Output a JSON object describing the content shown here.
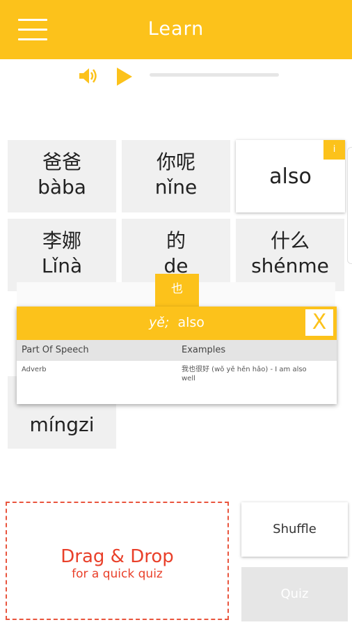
{
  "header": {
    "title": "Learn",
    "menu_icon": "hamburger-icon"
  },
  "audio": {
    "volume_icon": "volume-icon",
    "play_icon": "play-icon",
    "progress": 0,
    "accent": "#FCC21B"
  },
  "tiles": [
    {
      "hanzi": "爸爸",
      "pinyin": "bàba"
    },
    {
      "hanzi": "你呢",
      "pinyin": "nǐne"
    },
    {
      "word": "also",
      "badge": "i"
    },
    {
      "hanzi": "李娜",
      "pinyin": "Lǐnà"
    },
    {
      "hanzi": "的",
      "pinyin": "de"
    },
    {
      "hanzi": "什么",
      "pinyin": "shénme"
    },
    {
      "pinyin": "míngzi"
    }
  ],
  "popup": {
    "tab": "也",
    "pinyin": "yě;",
    "meaning": "also",
    "close": "X",
    "col_pos": "Part Of Speech",
    "col_examples": "Examples",
    "pos": "Adverb",
    "example": "我也很好 (wǒ yě hěn hǎo) - I am also well"
  },
  "quiz": {
    "drop_title": "Drag & Drop",
    "drop_sub": "for a quick quiz",
    "shuffle": "Shuffle",
    "quiz": "Quiz"
  },
  "colors": {
    "brand": "#FCC21B",
    "drop": "#E9402A"
  }
}
